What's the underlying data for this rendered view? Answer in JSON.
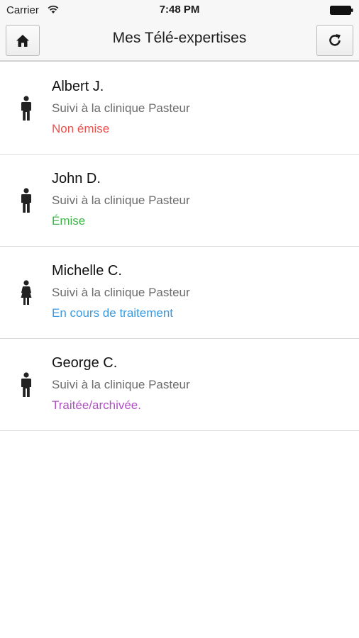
{
  "status_bar": {
    "carrier": "Carrier",
    "time": "7:48 PM",
    "wifi_icon": "wifi-icon",
    "battery_icon": "battery-icon"
  },
  "nav": {
    "title": "Mes Télé-expertises",
    "home_icon": "home-icon",
    "refresh_icon": "refresh-icon"
  },
  "patients": [
    {
      "name": "Albert J.",
      "clinic": "Suivi à la clinique Pasteur",
      "status": "Non émise",
      "status_color": "#e8524e",
      "gender": "male"
    },
    {
      "name": "John D.",
      "clinic": "Suivi à la clinique Pasteur",
      "status": "Émise",
      "status_color": "#3fb54a",
      "gender": "male"
    },
    {
      "name": "Michelle C.",
      "clinic": "Suivi à la clinique Pasteur",
      "status": "En cours de traitement",
      "status_color": "#3b9ae2",
      "gender": "female"
    },
    {
      "name": "George C.",
      "clinic": "Suivi à la clinique Pasteur",
      "status": "Traitée/archivée.",
      "status_color": "#b14fc5",
      "gender": "male"
    }
  ]
}
